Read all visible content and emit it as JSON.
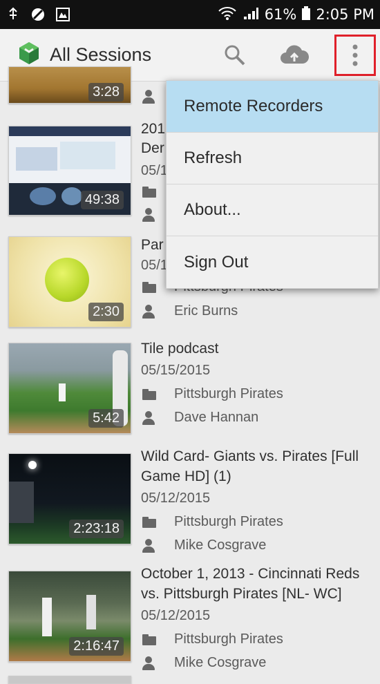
{
  "status_bar": {
    "battery": "61%",
    "time": "2:05 PM",
    "icons": [
      "usb-icon",
      "block-icon",
      "image-icon",
      "wifi-icon",
      "signal-icon",
      "battery-icon"
    ]
  },
  "app_bar": {
    "title": "All Sessions",
    "actions": [
      "search-icon",
      "cloud-upload-icon",
      "overflow-menu-icon"
    ]
  },
  "menu": {
    "items": [
      {
        "label": "Remote Recorders"
      },
      {
        "label": "Refresh"
      },
      {
        "label": "About..."
      },
      {
        "label": "Sign Out"
      }
    ]
  },
  "sessions": [
    {
      "title": "",
      "date": "",
      "folder": "",
      "owner": "",
      "duration": "3:28"
    },
    {
      "title": "201",
      "title2": "Der",
      "date": "05/1",
      "folder": "",
      "owner": "",
      "duration": "49:38"
    },
    {
      "title": "Par",
      "date": "05/1",
      "folder": "Pittsburgh Pirates",
      "owner": "Eric Burns",
      "duration": "2:30"
    },
    {
      "title": "Tile podcast",
      "date": "05/15/2015",
      "folder": "Pittsburgh Pirates",
      "owner": "Dave Hannan",
      "duration": "5:42"
    },
    {
      "title": "Wild Card- Giants vs. Pirates [Full Game HD] (1)",
      "date": "05/12/2015",
      "folder": "Pittsburgh Pirates",
      "owner": "Mike Cosgrave",
      "duration": "2:23:18"
    },
    {
      "title": "October 1, 2013 - Cincinnati Reds vs. Pittsburgh Pirates [NL- WC]",
      "date": "05/12/2015",
      "folder": "Pittsburgh Pirates",
      "owner": "Mike Cosgrave",
      "duration": "2:16:47"
    }
  ],
  "colors": {
    "menu_highlight": "#b7ddf2",
    "overflow_outline": "#e0202a",
    "logo_green": "#3a9a4a"
  }
}
